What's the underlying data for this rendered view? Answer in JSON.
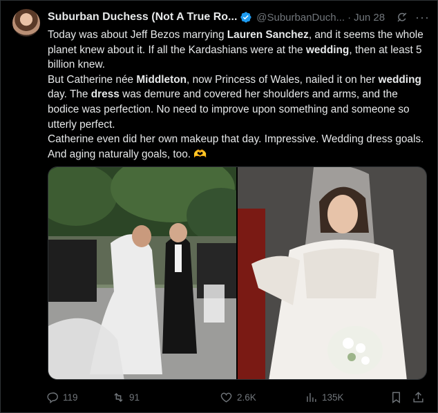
{
  "post": {
    "author_name": "Suburban Duchess (Not A True Ro...",
    "handle": "@SuburbanDuch...",
    "separator": "·",
    "date": "Jun 28",
    "more_label": "···",
    "paragraph1": [
      {
        "t": "Today was about Jeff Bezos marrying ",
        "b": false
      },
      {
        "t": "Lauren Sanchez",
        "b": true
      },
      {
        "t": ", and it seems the whole planet knew about it. If all the Kardashians were at the ",
        "b": false
      },
      {
        "t": "wedding",
        "b": true
      },
      {
        "t": ", then at least 5 billion knew.",
        "b": false
      }
    ],
    "paragraph2": [
      {
        "t": "But Catherine née ",
        "b": false
      },
      {
        "t": "Middleton",
        "b": true
      },
      {
        "t": ", now Princess of Wales, nailed it on her ",
        "b": false
      },
      {
        "t": "wedding",
        "b": true
      },
      {
        "t": " day. The ",
        "b": false
      },
      {
        "t": "dress",
        "b": true
      },
      {
        "t": " was demure and covered her shoulders and arms, and the bodice was perfection. No need to improve upon something and someone so utterly perfect.",
        "b": false
      }
    ],
    "paragraph3": "Catherine even did her own makeup that day. Impressive. Wedding dress goals. And aging naturally goals, too.",
    "emoji": "🫶"
  },
  "actions": {
    "replies": "119",
    "reposts": "91",
    "likes": "2.6K",
    "views": "135K"
  },
  "colors": {
    "background": "#000000",
    "text": "#e7e9ea",
    "muted": "#71767b",
    "verified": "#1d9bf0",
    "border": "#2f3336"
  }
}
